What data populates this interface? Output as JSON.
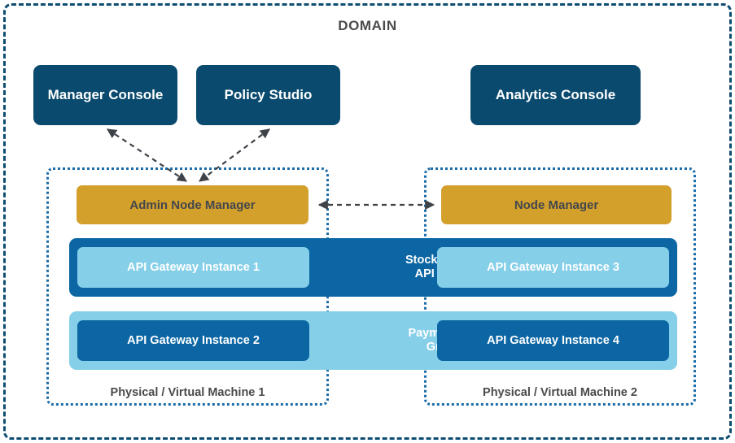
{
  "domain": {
    "title": "DOMAIN",
    "border_color": "#0d4d72"
  },
  "consoles": [
    {
      "id": "manager-console",
      "label": "Manager Console",
      "color": "#0a4a6e"
    },
    {
      "id": "policy-studio",
      "label": "Policy Studio",
      "color": "#0a4a6e"
    },
    {
      "id": "analytics-console",
      "label": "Analytics Console",
      "color": "#0a4a6e"
    }
  ],
  "machines": [
    {
      "id": "vm1",
      "label": "Physical / Virtual Machine 1",
      "node_manager": "Admin Node Manager"
    },
    {
      "id": "vm2",
      "label": "Physical / Virtual Machine 2",
      "node_manager": "Node Manager"
    }
  ],
  "node_manager_color": "#d4a02c",
  "api_groups": [
    {
      "id": "stock-control",
      "label": "Stock Control\nAPI Group",
      "label_line1": "Stock Control",
      "label_line2": "API Group",
      "band_color": "#0b66a3",
      "instance_color": "#85cfe8",
      "instances": [
        {
          "id": "instance-1",
          "label": "API Gateway Instance 1"
        },
        {
          "id": "instance-3",
          "label": "API Gateway Instance 3"
        }
      ]
    },
    {
      "id": "payment",
      "label": "Payment API\nGroup",
      "label_line1": "Payment API",
      "label_line2": "Group",
      "band_color": "#85cfe8",
      "instance_color": "#0b66a3",
      "instances": [
        {
          "id": "instance-2",
          "label": "API Gateway Instance 2"
        },
        {
          "id": "instance-4",
          "label": "API Gateway Instance 4"
        }
      ]
    }
  ],
  "connectors": [
    {
      "id": "manager-console-to-admin-node-manager",
      "style": "dashed",
      "arrow": "double",
      "color": "#3e4349"
    },
    {
      "id": "policy-studio-to-admin-node-manager",
      "style": "dashed",
      "arrow": "double",
      "color": "#3e4349"
    },
    {
      "id": "admin-node-manager-to-node-manager",
      "style": "dashed",
      "arrow": "double",
      "color": "#3e4349"
    }
  ]
}
